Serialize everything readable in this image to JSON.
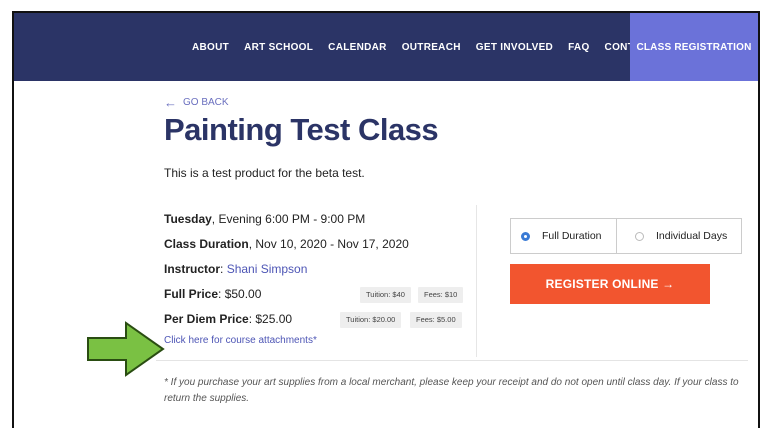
{
  "nav": {
    "items": [
      "ABOUT",
      "ART SCHOOL",
      "CALENDAR",
      "OUTREACH",
      "GET INVOLVED",
      "FAQ",
      "CONTACT"
    ],
    "cta": "CLASS REGISTRATION"
  },
  "page": {
    "back_label": "GO BACK",
    "title": "Painting Test Class",
    "description": "This is a test product for the beta test."
  },
  "details": {
    "day_label": "Tuesday",
    "day_value": ", Evening 6:00 PM - 9:00 PM",
    "duration_label": "Class Duration",
    "duration_value": ", Nov 10, 2020 - Nov 17, 2020",
    "instructor_label": "Instructor",
    "instructor_value": "Shani Simpson",
    "full_price_label": "Full Price",
    "full_price_value": ": $50.00",
    "full_tuition": "Tuition: $40",
    "full_fees": "Fees: $10",
    "perdiem_label": "Per Diem Price",
    "perdiem_value": ": $25.00",
    "perdiem_tuition": "Tuition: $20.00",
    "perdiem_fees": "Fees: $5.00",
    "attachments_link": "Click here for course attachments*"
  },
  "registration": {
    "option_full": "Full Duration",
    "option_individual": "Individual Days",
    "selected": "Full Duration",
    "register_label": "REGISTER ONLINE →"
  },
  "footnote": "* If you purchase your art supplies from a local merchant, please keep your receipt and do not open until class day. If your class to return the supplies.",
  "colors": {
    "nav_bg": "#2b3466",
    "cta_bg": "#6b72d9",
    "register_bg": "#f2552f",
    "link": "#4d55b5",
    "annotation_arrow": "#7ac143"
  }
}
